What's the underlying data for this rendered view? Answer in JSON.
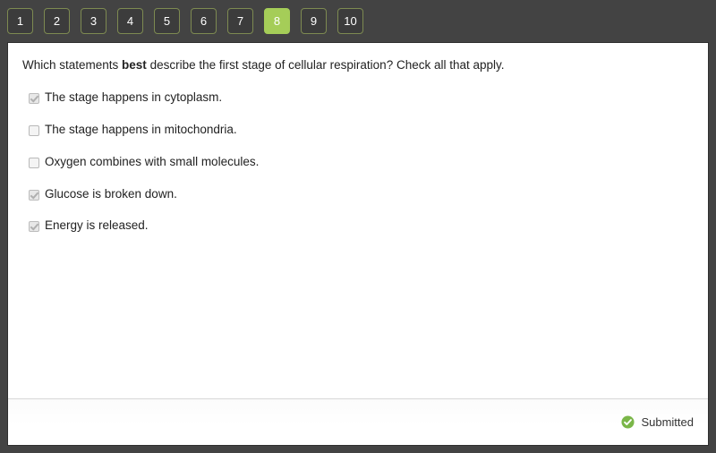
{
  "nav": {
    "buttons": [
      {
        "label": "1",
        "active": false
      },
      {
        "label": "2",
        "active": false
      },
      {
        "label": "3",
        "active": false
      },
      {
        "label": "4",
        "active": false
      },
      {
        "label": "5",
        "active": false
      },
      {
        "label": "6",
        "active": false
      },
      {
        "label": "7",
        "active": false
      },
      {
        "label": "8",
        "active": true
      },
      {
        "label": "9",
        "active": false
      },
      {
        "label": "10",
        "active": false
      }
    ],
    "active_color": "#a5cd58",
    "border_color": "#7d8a51",
    "bar_color": "#434343"
  },
  "question": {
    "prompt_before": "Which statements ",
    "prompt_emphasis": "best",
    "prompt_after": " describe the first stage of cellular respiration? Check all that apply.",
    "options": [
      {
        "label": "The stage happens in cytoplasm.",
        "checked": true
      },
      {
        "label": "The stage happens in mitochondria.",
        "checked": false
      },
      {
        "label": "Oxygen combines with small molecules.",
        "checked": false
      },
      {
        "label": "Glucose is broken down.",
        "checked": true
      },
      {
        "label": "Energy is released.",
        "checked": true
      }
    ]
  },
  "footer": {
    "status_label": "Submitted",
    "status_icon": "check-circle-icon",
    "status_color": "#7ab648"
  }
}
